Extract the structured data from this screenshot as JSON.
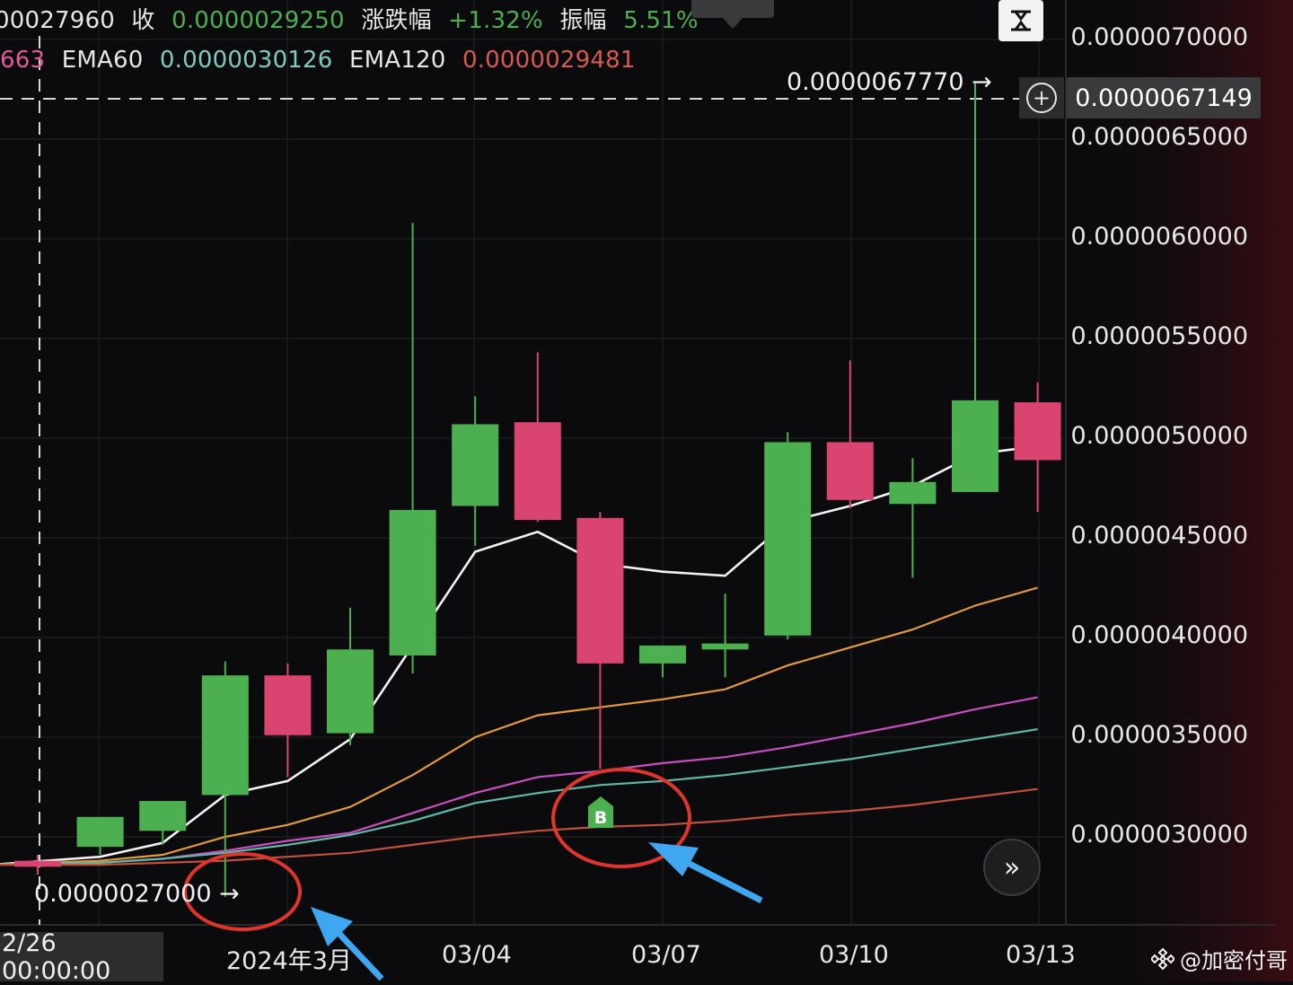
{
  "header": {
    "row1": {
      "prev_value": "00027960",
      "close_label": "收",
      "close_value": "0.0000029250",
      "change_label": "涨跌幅",
      "change_value": "+1.32%",
      "amplitude_label": "振幅",
      "amplitude_value": "5.51%"
    },
    "row2": {
      "prev_ema_value": "663",
      "ema60_label": "EMA60",
      "ema60_value": "0.0000030126",
      "ema120_label": "EMA120",
      "ema120_value": "0.0000029481"
    }
  },
  "colors": {
    "up": "#4caf50",
    "down": "#d94470",
    "ema_white": "#f2f2f2",
    "ema_orange": "#e39a3b",
    "ema_magenta": "#c94fc1",
    "ema_teal": "#5fb8a8",
    "ema_brown": "#c0523c",
    "annotation_circle": "#e0352b",
    "annotation_arrow": "#3ea7f0"
  },
  "current_price": "0.0000067149",
  "max_label": "0.0000067770",
  "min_label": "0.0000027000",
  "crosshair_time": "2/26 00:00:00",
  "buy_marker": "B",
  "watermark": "@加密付哥",
  "chart_data": {
    "type": "candlestick",
    "y_ticks": [
      "0.0000070000",
      "0.0000065000",
      "0.0000060000",
      "0.0000055000",
      "0.0000050000",
      "0.0000045000",
      "0.0000040000",
      "0.0000035000",
      "0.0000030000"
    ],
    "x_ticks": [
      "2024年3月",
      "03/04",
      "03/07",
      "03/10",
      "03/13"
    ],
    "ylim": [
      2.6e-06,
      7.1e-06
    ],
    "candles": [
      {
        "o": 2.88e-06,
        "h": 2.91e-06,
        "l": 2.81e-06,
        "c": 2.85e-06
      },
      {
        "o": 2.95e-06,
        "h": 3.06e-06,
        "l": 2.91e-06,
        "c": 3.1e-06
      },
      {
        "o": 3.03e-06,
        "h": 3.18e-06,
        "l": 2.96e-06,
        "c": 3.18e-06
      },
      {
        "o": 3.21e-06,
        "h": 3.88e-06,
        "l": 2.7e-06,
        "c": 3.81e-06
      },
      {
        "o": 3.81e-06,
        "h": 3.87e-06,
        "l": 3.3e-06,
        "c": 3.51e-06
      },
      {
        "o": 3.52e-06,
        "h": 4.15e-06,
        "l": 3.46e-06,
        "c": 3.94e-06
      },
      {
        "o": 3.91e-06,
        "h": 6.08e-06,
        "l": 3.82e-06,
        "c": 4.64e-06
      },
      {
        "o": 4.66e-06,
        "h": 5.21e-06,
        "l": 4.46e-06,
        "c": 5.07e-06
      },
      {
        "o": 5.08e-06,
        "h": 5.43e-06,
        "l": 4.58e-06,
        "c": 4.59e-06
      },
      {
        "o": 4.6e-06,
        "h": 4.63e-06,
        "l": 3.34e-06,
        "c": 3.87e-06
      },
      {
        "o": 3.87e-06,
        "h": 3.94e-06,
        "l": 3.8e-06,
        "c": 3.96e-06
      },
      {
        "o": 3.94e-06,
        "h": 4.22e-06,
        "l": 3.8e-06,
        "c": 3.97e-06
      },
      {
        "o": 4.01e-06,
        "h": 5.03e-06,
        "l": 3.99e-06,
        "c": 4.98e-06
      },
      {
        "o": 4.98e-06,
        "h": 5.39e-06,
        "l": 4.65e-06,
        "c": 4.69e-06
      },
      {
        "o": 4.67e-06,
        "h": 4.9e-06,
        "l": 4.3e-06,
        "c": 4.78e-06
      },
      {
        "o": 4.73e-06,
        "h": 6.78e-06,
        "l": 4.73e-06,
        "c": 5.19e-06
      },
      {
        "o": 5.18e-06,
        "h": 5.28e-06,
        "l": 4.63e-06,
        "c": 4.89e-06
      }
    ],
    "ema_lines": [
      {
        "color": "#f2f2f2",
        "values": [
          2.86e-06,
          2.9e-06,
          2.97e-06,
          3.21e-06,
          3.28e-06,
          3.49e-06,
          3.96e-06,
          4.43e-06,
          4.53e-06,
          4.37e-06,
          4.33e-06,
          4.31e-06,
          4.58e-06,
          4.66e-06,
          4.76e-06,
          4.92e-06,
          4.96e-06
        ]
      },
      {
        "color": "#e39a3b",
        "values": [
          2.86e-06,
          2.88e-06,
          2.91e-06,
          3e-06,
          3.06e-06,
          3.15e-06,
          3.31e-06,
          3.5e-06,
          3.61e-06,
          3.65e-06,
          3.69e-06,
          3.74e-06,
          3.86e-06,
          3.95e-06,
          4.04e-06,
          4.16e-06,
          4.25e-06
        ]
      },
      {
        "color": "#c94fc1",
        "values": [
          2.86e-06,
          2.87e-06,
          2.89e-06,
          2.93e-06,
          2.98e-06,
          3.02e-06,
          3.12e-06,
          3.22e-06,
          3.3e-06,
          3.33e-06,
          3.37e-06,
          3.4e-06,
          3.45e-06,
          3.51e-06,
          3.57e-06,
          3.64e-06,
          3.7e-06
        ]
      },
      {
        "color": "#5fb8a8",
        "values": [
          2.86e-06,
          2.87e-06,
          2.89e-06,
          2.92e-06,
          2.96e-06,
          3.01e-06,
          3.08e-06,
          3.17e-06,
          3.22e-06,
          3.26e-06,
          3.28e-06,
          3.31e-06,
          3.35e-06,
          3.39e-06,
          3.44e-06,
          3.49e-06,
          3.54e-06
        ]
      },
      {
        "color": "#c0523c",
        "values": [
          2.86e-06,
          2.86e-06,
          2.87e-06,
          2.88e-06,
          2.9e-06,
          2.92e-06,
          2.96e-06,
          3e-06,
          3.03e-06,
          3.05e-06,
          3.06e-06,
          3.08e-06,
          3.11e-06,
          3.13e-06,
          3.16e-06,
          3.2e-06,
          3.24e-06
        ]
      }
    ]
  }
}
